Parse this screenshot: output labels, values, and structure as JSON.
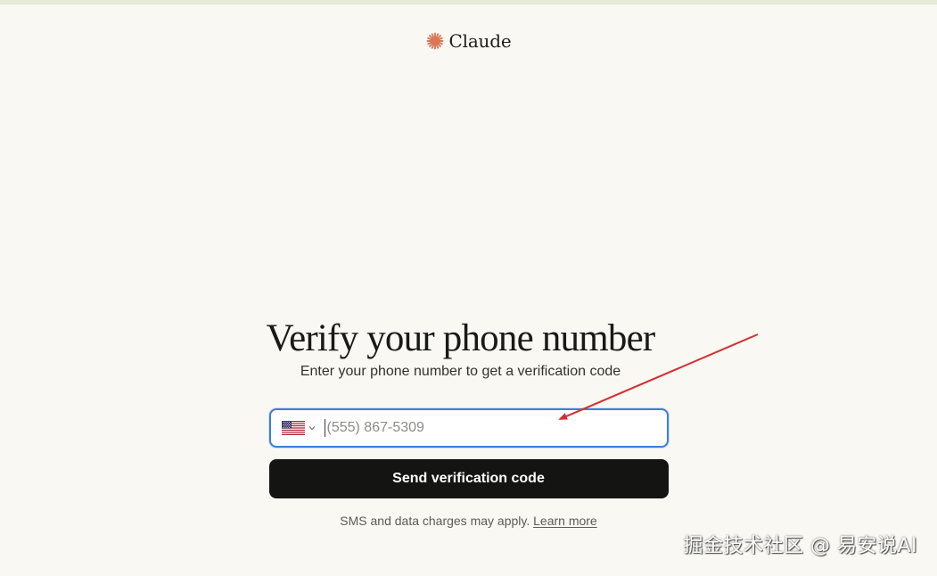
{
  "brand": {
    "name": "Claude",
    "icon": "claude-spark-icon",
    "icon_color": "#d97757"
  },
  "main": {
    "title": "Verify your phone number",
    "subtitle": "Enter your phone number to get a verification code"
  },
  "phone_field": {
    "country_flag": "us-flag-icon",
    "value": "",
    "placeholder": "(555) 867-5309",
    "focus_color": "#3d7fd6"
  },
  "send_button": {
    "label": "Send verification code",
    "color": "#141413"
  },
  "disclaimer": {
    "text": "SMS and data charges may apply. ",
    "link_text": "Learn more"
  },
  "annotation": {
    "arrow_color": "#d32f2f"
  },
  "watermark": {
    "text": "掘金技术社区 @ 易安说AI"
  }
}
